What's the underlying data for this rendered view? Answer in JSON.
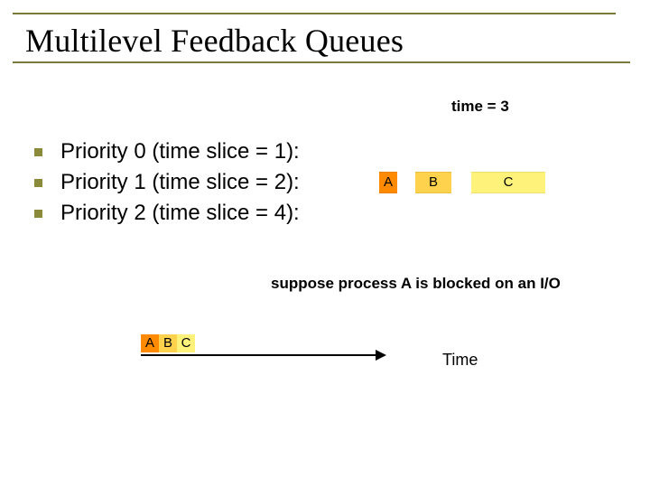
{
  "title": "Multilevel Feedback Queues",
  "time_label": "time = 3",
  "bullets": [
    "Priority 0 (time slice = 1):",
    "Priority 1 (time slice = 2):",
    "Priority 2 (time slice = 4):"
  ],
  "queue_labels": {
    "a": "A",
    "b": "B",
    "c": "C"
  },
  "note": "suppose process A is blocked on an I/O",
  "timeline": {
    "a": "A",
    "b": "B",
    "c": "C"
  },
  "time_axis": "Time"
}
